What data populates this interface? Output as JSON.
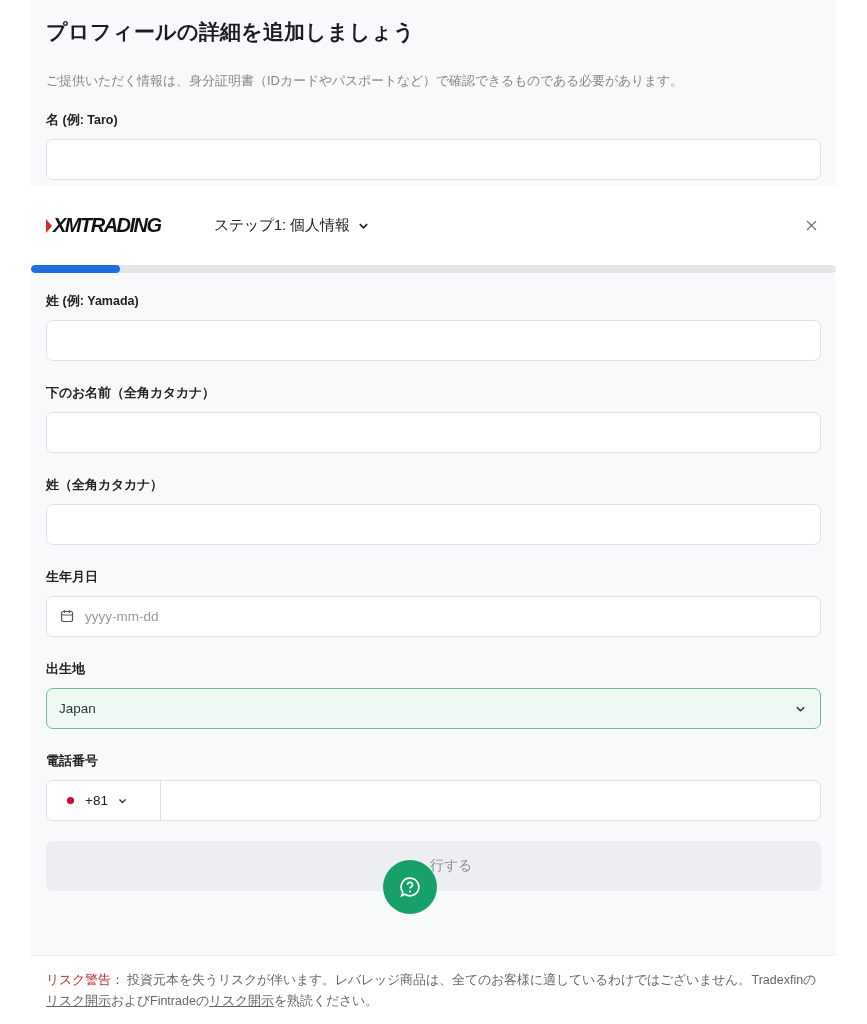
{
  "intro": {
    "title": "プロフィールの詳細を追加しましょう",
    "description": "ご提供いただく情報は、身分証明書（IDカードやパスポートなど）で確認できるものである必要があります。",
    "field": {
      "kind": "text",
      "label": "名 (例: Taro)",
      "valid": false
    }
  },
  "header": {
    "logo": "XMTRADING",
    "step": "ステップ1: 個人情報",
    "progress": {
      "level": 0.11
    }
  },
  "fields": [
    {
      "kind": "text",
      "label": "姓 (例: Yamada)",
      "valid": false
    },
    {
      "kind": "text",
      "label": "下のお名前（全角カタカナ）",
      "valid": false
    },
    {
      "kind": "text",
      "label": "姓（全角カタカナ）",
      "valid": false
    },
    {
      "kind": "date",
      "label": "生年月日",
      "placeholder": "yyyy-mm-dd",
      "valid": false
    },
    {
      "kind": "select",
      "label": "出生地",
      "value": "Japan",
      "valid": true
    },
    {
      "kind": "phone",
      "label": "電話番号",
      "code": "+81",
      "valid": false
    }
  ],
  "submit": {
    "label": "行する",
    "disabled": true
  },
  "risk": [
    {
      "kind": "warning",
      "text": "リスク警告："
    },
    {
      "kind": "text",
      "text": " 投資元本を失うリスクが伴います。レバレッジ商品は、全てのお客様に適しているわけではございません。Tradexfinの"
    },
    {
      "kind": "link",
      "text": "リスク開示"
    },
    {
      "kind": "text",
      "text": "およびFintradeの"
    },
    {
      "kind": "link",
      "text": "リスク開示"
    },
    {
      "kind": "text",
      "text": "を熟読ください。"
    }
  ]
}
